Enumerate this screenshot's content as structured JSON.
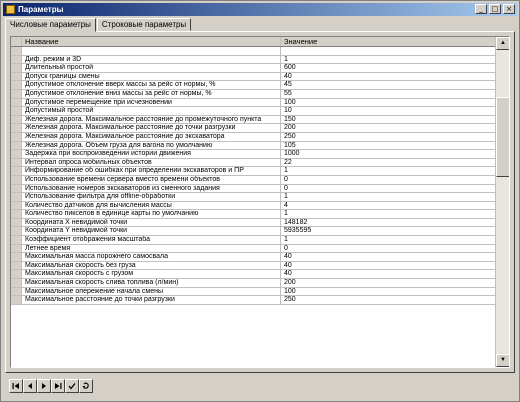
{
  "window": {
    "title": "Параметры"
  },
  "title_buttons": [
    "_",
    "□",
    "×"
  ],
  "tabs": [
    {
      "label": "Числовые параметры",
      "active": true
    },
    {
      "label": "Строковые параметры",
      "active": false
    }
  ],
  "grid": {
    "headers": {
      "name": "Название",
      "value": "Значение"
    },
    "rows": [
      {
        "name": "",
        "value": ""
      },
      {
        "name": "Диф. режим и 3D",
        "value": "1"
      },
      {
        "name": "Длительный простой",
        "value": "600"
      },
      {
        "name": "Допуск границы смены",
        "value": "40"
      },
      {
        "name": "Допустимое отклонение вверх массы за рейс от нормы, %",
        "value": "45"
      },
      {
        "name": "Допустимое отклонение вниз массы за рейс от нормы, %",
        "value": "55"
      },
      {
        "name": "Допустимое перемещение при исчезновении",
        "value": "100"
      },
      {
        "name": "Допустимый простой",
        "value": "10"
      },
      {
        "name": "Железная дорога. Максимальное расстояние до промежуточного пункта",
        "value": "150"
      },
      {
        "name": "Железная дорога. Максимальное расстояние до точки разгрузки",
        "value": "200"
      },
      {
        "name": "Железная дорога. Максимальное расстояние до экскаватора",
        "value": "250"
      },
      {
        "name": "Железная дорога. Объем груза для вагона по умолчанию",
        "value": "105"
      },
      {
        "name": "Задержка при воспроизведении истории движения",
        "value": "1000"
      },
      {
        "name": "Интервал опроса мобильных объектов",
        "value": "22"
      },
      {
        "name": "Информирование об ошибках при определении экскаваторов и ПР",
        "value": "1"
      },
      {
        "name": "Использование времени сервера вместо времени объектов",
        "value": "0"
      },
      {
        "name": "Использование номеров экскаваторов из сменного задания",
        "value": "0"
      },
      {
        "name": "Использование фильтра для offline-обработки",
        "value": "1"
      },
      {
        "name": "Количество датчиков для вычисления массы",
        "value": "4"
      },
      {
        "name": "Количество пикселов в единице карты по умолчанию",
        "value": "1"
      },
      {
        "name": "Координата X невидимой точки",
        "value": "148182"
      },
      {
        "name": "Координата Y невидимой точки",
        "value": "5935595"
      },
      {
        "name": "Коэффициент отображения масштаба",
        "value": "1"
      },
      {
        "name": "Летнее время",
        "value": "0"
      },
      {
        "name": "Максимальная масса порожнего самосвала",
        "value": "40"
      },
      {
        "name": "Максимальная скорость без груза",
        "value": "40"
      },
      {
        "name": "Максимальная скорость с грузом",
        "value": "40"
      },
      {
        "name": "Максимальная скорость слива топлива (л/мин)",
        "value": "200"
      },
      {
        "name": "Максимальное опережение начала смены",
        "value": "100"
      },
      {
        "name": "Максимальное расстояние до точки разгрузки",
        "value": "250"
      }
    ]
  },
  "scrollbar": {
    "up_icon": "scroll-up-arrow-icon",
    "down_icon": "scroll-down-arrow-icon"
  },
  "navigator": {
    "buttons": [
      {
        "icon": "first-record-icon"
      },
      {
        "icon": "prior-record-icon"
      },
      {
        "icon": "next-record-icon"
      },
      {
        "icon": "last-record-icon"
      },
      {
        "icon": "post-checkmark-icon"
      },
      {
        "icon": "cancel-icon"
      }
    ]
  }
}
